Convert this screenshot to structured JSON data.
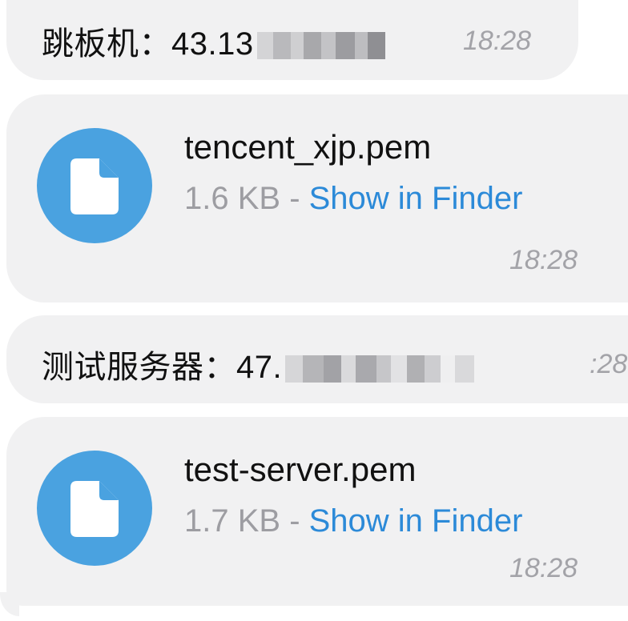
{
  "messages": [
    {
      "type": "text",
      "label": "跳板机：",
      "visible_value": "43.13",
      "time": "18:28"
    },
    {
      "type": "file",
      "file_name": "tencent_xjp.pem",
      "file_size": "1.6 KB",
      "separator": " - ",
      "action_label": "Show in Finder",
      "icon": "file-icon",
      "time": "18:28"
    },
    {
      "type": "text",
      "label": "测试服务器：",
      "visible_value": "47.",
      "time": ":28"
    },
    {
      "type": "file",
      "file_name": "test-server.pem",
      "file_size": "1.7 KB",
      "separator": " - ",
      "action_label": "Show in Finder",
      "icon": "file-icon",
      "time": "18:28"
    }
  ],
  "colors": {
    "bubble": "#f1f1f2",
    "file_icon_bg": "#4aa2e0",
    "link": "#2c8ad8",
    "muted_text": "#9d9da2"
  }
}
